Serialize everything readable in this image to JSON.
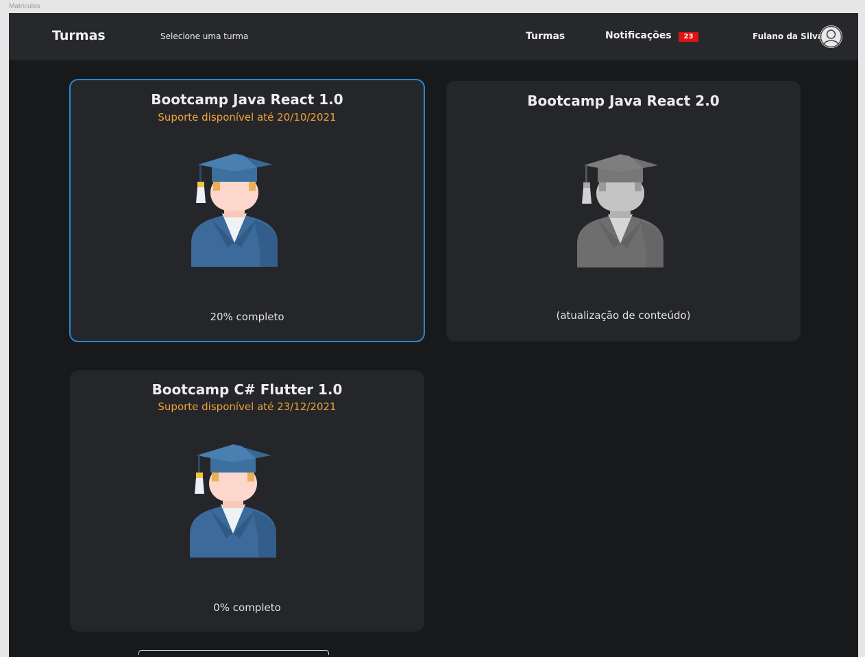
{
  "window": {
    "label": "Matriculas"
  },
  "header": {
    "brand": "Turmas",
    "subtitle": "Selecione uma turma",
    "nav_turmas": "Turmas",
    "nav_notifications": "Notificações",
    "notification_count": "23",
    "user_name": "Fulano da Silva"
  },
  "courses": [
    {
      "title": "Bootcamp Java React 1.0",
      "support": "Suporte disponível até 20/10/2021",
      "status": "20% completo",
      "selected": true,
      "enabled": true
    },
    {
      "title": "Bootcamp Java React 2.0",
      "support": "",
      "status": "(atualização de conteúdo)",
      "selected": false,
      "enabled": false
    },
    {
      "title": "Bootcamp C# Flutter 1.0",
      "support": "Suporte disponível até 23/12/2021",
      "status": "0% completo",
      "selected": false,
      "enabled": true
    }
  ],
  "icons": {
    "course_active": "graduate-student-icon",
    "course_disabled": "graduate-student-gray-icon",
    "avatar": "user-avatar-icon"
  },
  "colors": {
    "accent": "#2787d6",
    "support_text": "#f0a33a",
    "badge": "#e01414",
    "card_bg": "#25262a",
    "page_bg": "#18191b"
  }
}
